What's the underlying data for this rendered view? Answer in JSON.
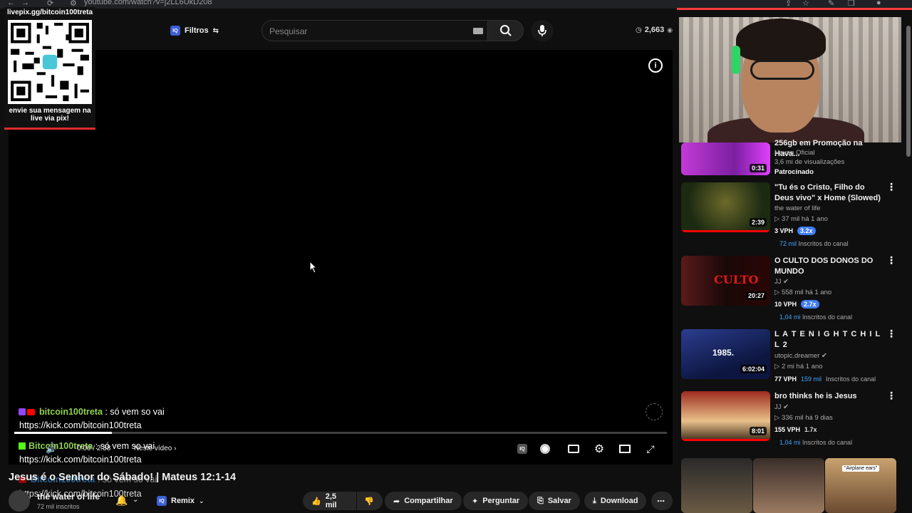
{
  "browser": {
    "url": "youtube.com/watch?v=j2LL6UkD208"
  },
  "header": {
    "filters_label": "Filtros",
    "filters_badge": "IQ",
    "search_placeholder": "Pesquisar",
    "view_count": "2,663"
  },
  "overlay": {
    "qr_title": "livepix.gg/bitcoin100treta",
    "qr_caption_line1": "envie sua mensagem na",
    "qr_caption_line2": "live via pix!"
  },
  "chat": [
    {
      "platform": "twitch-youtube",
      "user": "bitcoin100treta",
      "message": ": só vem so vai"
    },
    {
      "platform": "none",
      "user": "",
      "message": "https://kick.com/bitcoin100treta"
    },
    {
      "platform": "kick",
      "user": "Bitcoin100treta",
      "message": ": só vem so vai"
    },
    {
      "platform": "none",
      "user": "",
      "message": "https://kick.com/bitcoin100treta"
    },
    {
      "platform": "youtube",
      "user": "Bitcoin100treta",
      "message": ": só vem so vai"
    },
    {
      "platform": "none",
      "user": "",
      "message": "https://kick.com/bitcoin100treta"
    }
  ],
  "player": {
    "time": "0:00 / 2:38",
    "chapter": "Neste vídeo",
    "progress": 0.15
  },
  "video": {
    "title": "Jesus é o Senhor do Sábado! | Mateus 12:1-14",
    "channel": "the water of life",
    "subscribers": "72 mil inscritos",
    "remix_label": "Remix",
    "likes": "2,5 mil",
    "share_label": "Compartilhar",
    "ask_label": "Perguntar",
    "save_label": "Salvar",
    "download_label": "Download"
  },
  "sidebar": {
    "items": [
      {
        "title": "256gb em Promoção na Hava...",
        "channel": "Havan Oficial",
        "views": "3,6 mi de visualizações",
        "sponsored": "Patrocinado",
        "duration": "0:31"
      },
      {
        "title": "\"Tu és o Cristo, Filho do Deus vivo\" x Home (Slowed)",
        "channel": "the water of life",
        "stats": "37 mil   há 1 ano",
        "vph": "3 VPH",
        "mult": "3.2x",
        "subs_count": "72 mil",
        "subs_label": "Inscritos do canal",
        "duration": "2:39"
      },
      {
        "title": "O CULTO DOS DONOS DO MUNDO",
        "channel": "JJ",
        "stats": "558 mil   há 1 ano",
        "vph": "10 VPH",
        "mult": "2.7x",
        "subs_count": "1,04 mi",
        "subs_label": "Inscritos do canal",
        "duration": "20:27"
      },
      {
        "title": "L A T E  N I G H T  C H I  L L  2",
        "channel": "utopic.dreamer",
        "stats": "2 mi   há 1 ano",
        "vph": "77 VPH",
        "subs_count": "159 mil",
        "subs_label": "Inscritos do canal",
        "duration": "6:02:04"
      },
      {
        "title": "bro thinks he is Jesus",
        "channel": "JJ",
        "stats": "336 mil   há 9 dias",
        "vph": "155 VPH",
        "mult": "1.7x",
        "subs_count": "1,04 mi",
        "subs_label": "Inscritos do canal",
        "duration": "8:01"
      }
    ],
    "shorts_caption": "\"Airplane ears\""
  }
}
